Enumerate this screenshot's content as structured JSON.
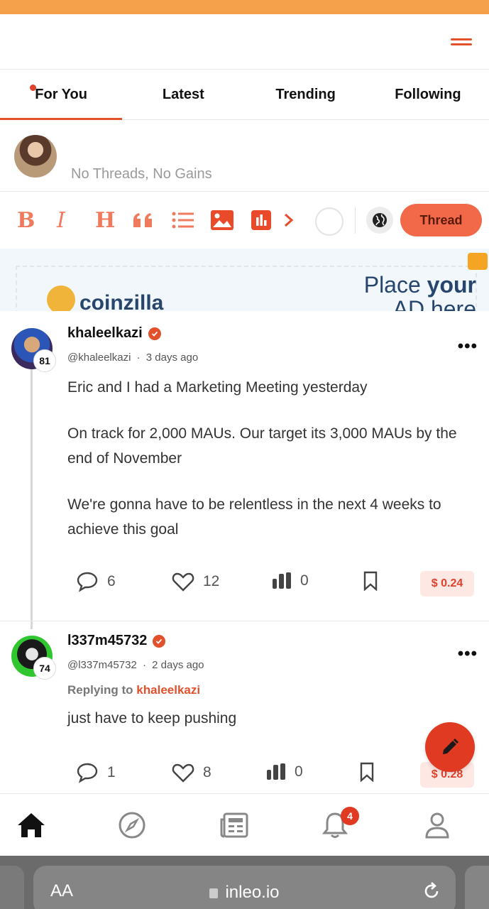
{
  "tabs": [
    {
      "label": "For You",
      "active": true
    },
    {
      "label": "Latest"
    },
    {
      "label": "Trending"
    },
    {
      "label": "Following"
    }
  ],
  "composer": {
    "placeholder": "No Threads, No Gains"
  },
  "toolbar": {
    "bold": "B",
    "italic": "I",
    "heading": "H",
    "thread_button": "Thread",
    "icons": [
      "bold-icon",
      "italic-icon",
      "heading-icon",
      "quote-icon",
      "list-icon",
      "image-icon",
      "poll-icon",
      "chevron-right-icon",
      "circle-icon",
      "globe-icon"
    ]
  },
  "ad": {
    "brand": "coinzilla",
    "cta_line1": "Place ",
    "cta_line1_bold": "your",
    "cta_line2": "AD here"
  },
  "posts": [
    {
      "username": "khaleelkazi",
      "handle": "@khaleelkazi",
      "time": "3 days ago",
      "reputation": "81",
      "paragraphs": [
        "Eric and I had a Marketing Meeting yesterday",
        "On track for 2,000 MAUs. Our target its 3,000 MAUs by the end of November",
        "We're gonna have to be relentless in the next 4 weeks to achieve this goal"
      ],
      "comments": "6",
      "likes": "12",
      "views": "0",
      "payout": "$ 0.24"
    },
    {
      "username": "l337m45732",
      "handle": "@l337m45732",
      "time": "2 days ago",
      "reputation": "74",
      "replying_label": "Replying to",
      "replying_to": "khaleelkazi",
      "paragraphs": [
        "just have to keep pushing"
      ],
      "comments": "1",
      "likes": "8",
      "views": "0",
      "payout": "$ 0.28"
    }
  ],
  "meta_separator": "·",
  "more_label": "•••",
  "bottom_nav": {
    "items": [
      "home-icon",
      "compass-icon",
      "news-icon",
      "bell-icon",
      "user-icon"
    ],
    "notification_count": "4"
  },
  "browser": {
    "aa": "AA",
    "url": "inleo.io"
  },
  "colors": {
    "accent": "#e0512c",
    "thread_button": "#f2694a",
    "top_strip": "#f5a04a"
  }
}
